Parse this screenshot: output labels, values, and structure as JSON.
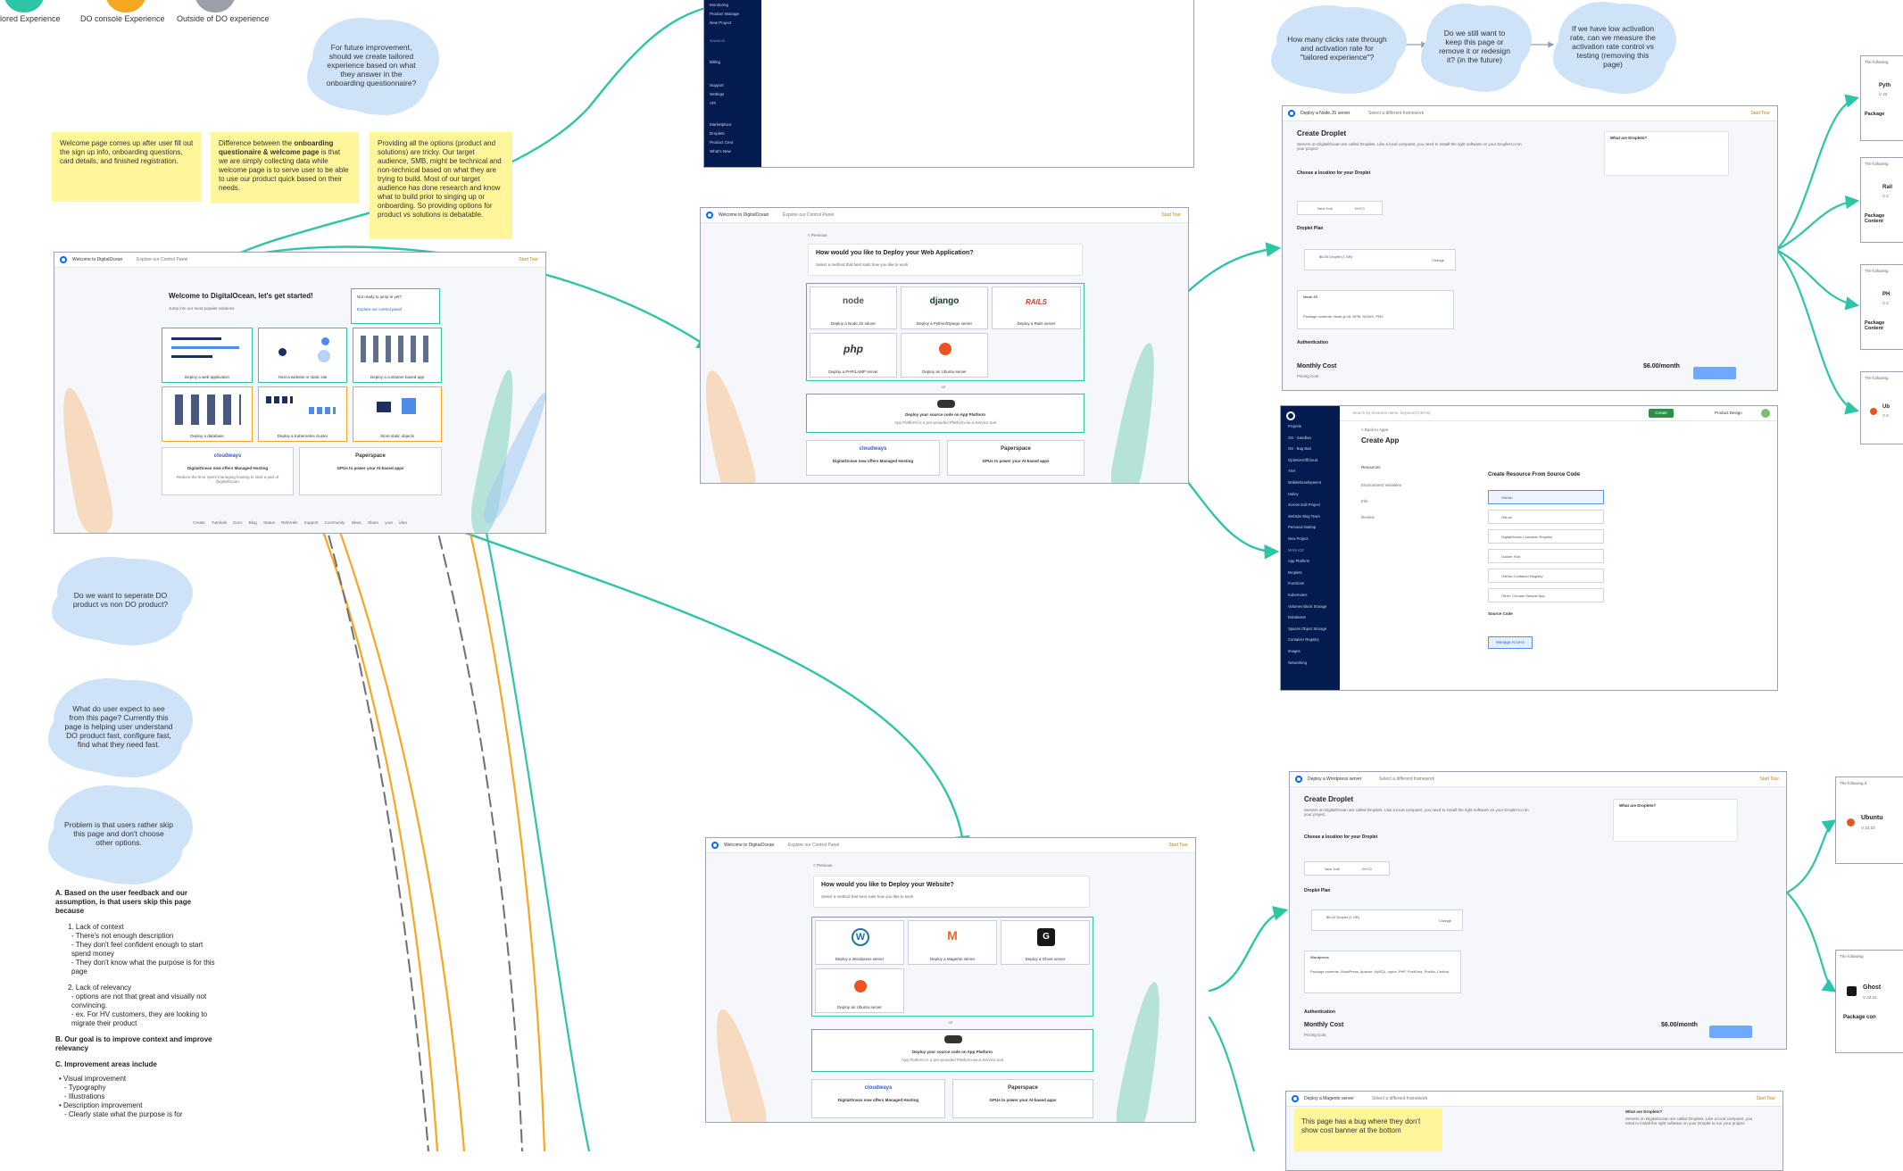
{
  "legend": [
    {
      "label": "lored Experience",
      "color": "#2ec4a6"
    },
    {
      "label": "DO console Experience",
      "color": "#f5a623"
    },
    {
      "label": "Outside of DO experience",
      "color": "#9aa0aa"
    }
  ],
  "clouds": {
    "future": "For future improvement, should we create tailored experience based on what they answer in the onboarding questionnaire?",
    "separate": "Do we want to seperate DO product vs non DO product?",
    "expect": "What do user expect to see from this page? Currently this page is helping user understand DO product fast, configure fast, find what they need fast.",
    "problem": "Problem is that users rather skip this page and don't choose other options.",
    "clicks": "How many clicks rate through and activation rate for \"tailored experience\"?",
    "keep": "Do we still want to keep this page or remove it or redesign it? (in the future)",
    "low": "If we have low activation rate, can we measure the activation rate control vs testing (removing this page)"
  },
  "stickies": {
    "welcome": "Welcome page comes up after user fill out the sign up info, onboarding questions, card details, and finished registration.",
    "difference_pre": "Difference between the ",
    "difference_bold": "onboarding questionaire & welcome page",
    "difference_post": " is that we are simply collecting data while welcome page is to serve user to be able to use our product quick based on their needs.",
    "options": "Providing all the options (product and solutions) are tricky. Our target audience, SMB, might be technical and non-technical based on what they are trying to build. Most of our target audience has done research and know what to build prior to singing up or onboarding. So providing options for product vs solutions is debatable.",
    "bug": "This page has a bug where they don't show cost banner at the bottom"
  },
  "notes": {
    "a_title": "A. Based on the user feedback and our assumption, is that users skip this page because",
    "a1": "1. Lack of context",
    "a1_items": [
      "- There's not enough description",
      "- They don't feel confident enough to start spend money",
      "- They don't know what the purpose is for this page"
    ],
    "a2": "2. Lack of relevancy",
    "a2_items": [
      "- options are not that great and visually not convincing.",
      "- ex. For HV customers, they are looking to migrate their product"
    ],
    "b_title": "B. Our goal is to improve context and improve relevancy",
    "c_title": "C. Improvement areas include",
    "c_items": [
      "• Visual improvement",
      "  - Typography",
      "  - Illustrations",
      "• Description improvement",
      "  - Clearly state what the purpose is for"
    ]
  },
  "welcome_frame": {
    "bar_title": "Welcome to DigitalOcean",
    "bar_sub": "Explore our Control Panel",
    "bar_start": "Start Tour",
    "heading": "Welcome to DigitalOcean, let's get started!",
    "sub": "Jump into our most popular solutions",
    "side_title": "Not ready to jump in yet?",
    "side_link": "Explore our control panel",
    "cards": [
      "Deploy a web application",
      "Host a website or static site",
      "Deploy a container-based app",
      "Deploy a database",
      "Deploy a Kubernetes cluster",
      "Store static objects"
    ],
    "promo1_brand": "cloudways",
    "promo1_title": "DigitalOcean now offers Managed Hosting",
    "promo1_desc": "Reduce the time spent managing hosting to start a part of DigitalOcean",
    "promo2_brand": "Paperspace",
    "promo2_title": "GPUs to power your AI-based apps",
    "footer": [
      "Create",
      "Tutorials",
      "Docs",
      "Blog",
      "Status",
      "Referrals",
      "Support",
      "Community",
      "Ideas",
      "Share your idea"
    ]
  },
  "webapp_frame": {
    "bar_title": "Welcome to DigitalOcean",
    "bar_sub": "Explore our Control Panel",
    "bar_start": "Start Tour",
    "back": "< Previous",
    "heading": "How would you like to Deploy your Web Application?",
    "sub": "Select a method that best suits how you like to work",
    "cards": [
      {
        "logo": "node",
        "label": "Deploy a Node.JS server"
      },
      {
        "logo": "django",
        "label": "Deploy a Python/Django server"
      },
      {
        "logo": "RAILS",
        "label": "Deploy a Rails server"
      },
      {
        "logo": "php",
        "label": "Deploy a PHP/LAMP server"
      },
      {
        "logo": "",
        "label": "Deploy an Ubuntu server"
      }
    ],
    "or": "or",
    "source_title": "Deploy your source code on App Platform",
    "source_desc": "App Platform is a pre-provided Platform-as-a-Service tool",
    "promo1_brand": "cloudways",
    "promo1_title": "DigitalOcean now offers Managed Hosting",
    "promo2_brand": "Paperspace",
    "promo2_title": "GPUs to power your AI-based apps"
  },
  "website_frame": {
    "bar_title": "Welcome to DigitalOcean",
    "bar_sub": "Explore our Control Panel",
    "bar_start": "Start Tour",
    "back": "< Previous",
    "heading": "How would you like to Deploy your Website?",
    "sub": "Select a method that best suits how you like to work",
    "cards": [
      {
        "logo": "W",
        "label": "Deploy a Wordpress server"
      },
      {
        "logo": "M",
        "label": "Deploy a Magento server"
      },
      {
        "logo": "G",
        "label": "Deploy a Ghost server"
      },
      {
        "logo": "",
        "label": "Deploy an Ubuntu server"
      }
    ],
    "or": "or",
    "source_title": "Deploy your source code on App Platform",
    "source_desc": "App Platform is a pre-provided Platform-as-a-Service tool",
    "promo1_brand": "cloudways",
    "promo1_title": "DigitalOcean now offers Managed Hosting",
    "promo2_brand": "Paperspace",
    "promo2_title": "GPUs to power your AI-based apps"
  },
  "droplet_node": {
    "bar_title": "Deploy a Node.JS server",
    "bar_sub": "Select a different framework",
    "bar_start": "Start Tour",
    "heading": "Create Droplet",
    "desc": "Servers on DigitalOcean are called Droplets. Like a local computer, you need to install the right software on your Droplet to run your project.",
    "location_title": "Choose a location for your Droplet",
    "location_value": "New York",
    "location_dc": "NYC3",
    "plan_title": "Droplet Plan",
    "plan_value": "$6.00 Droplet (1 GB)",
    "plan_change": "Change",
    "image_title": "Node.JS",
    "image_desc": "Package contents: Node.js 18, NPM, NGINX, PM2",
    "auth_title": "Authentication",
    "cost_label": "Monthly Cost",
    "cost_value": "$6.00/month",
    "cost_sub": "Pricing Cost",
    "info_title": "What are Droplets?"
  },
  "droplet_wp": {
    "bar_title": "Deploy a Wordpress server",
    "bar_sub": "Select a different framework",
    "bar_start": "Start Tour",
    "heading": "Create Droplet",
    "desc": "Servers on DigitalOcean are called Droplets. Like a local computer, you need to install the right software on your Droplet to run your project.",
    "location_title": "Choose a location for your Droplet",
    "location_value": "New York",
    "location_dc": "NYC3",
    "plan_title": "Droplet Plan",
    "plan_value": "$6.00 Droplet (1 GB)",
    "plan_change": "Change",
    "image_title": "Wordpress",
    "image_desc": "Package contents: WordPress, Apache, MySQL, nginx, PHP, PostGres, Postfix, Certbot",
    "auth_title": "Authentication",
    "cost_label": "Monthly Cost",
    "cost_value": "$6.00/month",
    "cost_sub": "Pricing Cost",
    "info_title": "What are Droplets?"
  },
  "droplet_magento": {
    "bar_title": "Deploy a Magento server",
    "bar_sub": "Select a different framework",
    "bar_start": "Start Tour",
    "info_title": "What are Droplets?",
    "desc": "Servers on DigitalOcean are called Droplets. Like a local computer, you need to install the right software on your Droplet to run your project."
  },
  "create_app": {
    "search": "Search by resource name, keyword (Ctrl+B)",
    "create_btn": "Create",
    "breadcrumb": "< Back to Apps",
    "heading": "Create App",
    "steps": [
      "Resources",
      "Environment Variables",
      "Info",
      "Review"
    ],
    "resource_title": "Create Resource From Source Code",
    "providers": [
      "GitHub",
      "GitLab",
      "DigitalOcean Container Registry",
      "Docker Hub",
      "GitHub Container Registry",
      "Other: Choose Sample App"
    ],
    "source_title": "Source Code",
    "manage": "Manage Access",
    "sidebar_items": [
      "Projects",
      "OS - Sandbox",
      "OS - Bug Bad",
      "OptimizeOffCloud",
      "ANA",
      "MobileDevelopment",
      "Hailey",
      "Screen Edit Project",
      "Website Blog Team",
      "Personal Startup",
      "New Project",
      "MANAGE",
      "App Platform",
      "Droplets",
      "Functions",
      "Kubernetes",
      "Volumes Block Storage",
      "Databases",
      "Spaces Object Storage",
      "Container Registry",
      "Images",
      "Networking"
    ],
    "top_user": "Product Design"
  },
  "top_frame": {
    "sidebar_items": [
      "Monitoring",
      "Product Manage",
      "New Project",
      "MANAGE",
      "Billing",
      "Support",
      "Settings",
      "API",
      "Marketplace",
      "Droplets",
      "Product Cent",
      "What's New"
    ]
  },
  "right_cards": [
    {
      "head": "The following",
      "title": "Pyth",
      "sub": "V 23",
      "pkg": "Package"
    },
    {
      "head": "The following",
      "title": "Rail",
      "sub": "V 2",
      "pkg": "Package Content"
    },
    {
      "head": "The following",
      "title": "PH",
      "sub": "V 2",
      "pkg": "Package Content"
    },
    {
      "head": "The following",
      "title": "Ub",
      "sub": "V 2",
      "pkg": ""
    },
    {
      "head": "The following d",
      "title": "Ubuntu",
      "sub": "V 23.10",
      "pkg": ""
    },
    {
      "head": "The following",
      "title": "Ghost",
      "sub": "V 23.10",
      "pkg": "Package con"
    }
  ]
}
